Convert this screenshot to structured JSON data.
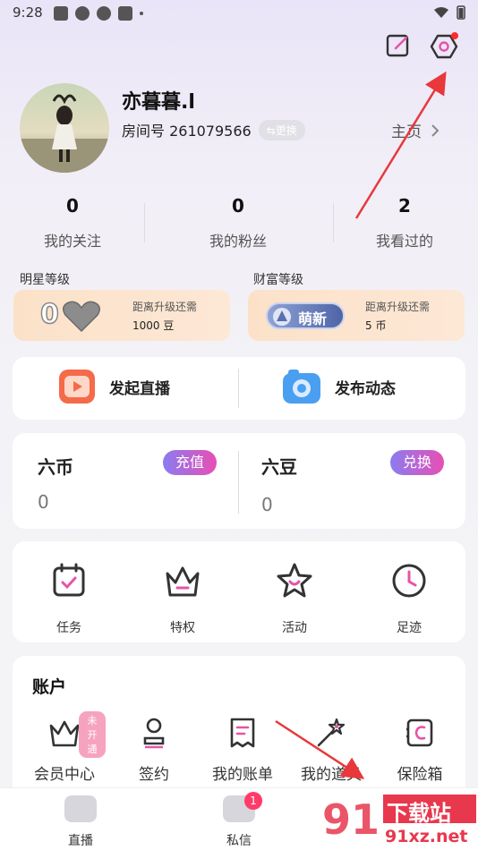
{
  "status_bar": {
    "time": "9:28"
  },
  "profile": {
    "nickname": "亦暮暮.l",
    "room_label": "房间号 261079566",
    "switch_label": "⇆更换",
    "home_label": "主页"
  },
  "stats": [
    {
      "value": "0",
      "label": "我的关注"
    },
    {
      "value": "0",
      "label": "我的粉丝"
    },
    {
      "value": "2",
      "label": "我看过的"
    }
  ],
  "levels": {
    "star": {
      "title": "明星等级",
      "level": "0",
      "sub": "距离升级还需",
      "value": "1000 豆"
    },
    "wealth": {
      "title": "财富等级",
      "badge": "萌新",
      "sub": "距离升级还需",
      "value": "5 币"
    }
  },
  "actions": {
    "live": "发起直播",
    "post": "发布动态"
  },
  "wallet": {
    "coin": {
      "title": "六币",
      "value": "0",
      "button": "充值"
    },
    "bean": {
      "title": "六豆",
      "value": "0",
      "button": "兑换"
    }
  },
  "quick": [
    {
      "label": "任务",
      "icon": "calendar-check-icon"
    },
    {
      "label": "特权",
      "icon": "crown-icon"
    },
    {
      "label": "活动",
      "icon": "star-icon"
    },
    {
      "label": "足迹",
      "icon": "clock-icon"
    }
  ],
  "account": {
    "title": "账户",
    "badge": "未开通",
    "items": [
      {
        "label": "会员中心",
        "icon": "crown-icon"
      },
      {
        "label": "签约",
        "icon": "stamp-icon"
      },
      {
        "label": "我的账单",
        "icon": "receipt-icon"
      },
      {
        "label": "我的道具",
        "icon": "magic-wand-icon"
      },
      {
        "label": "保险箱",
        "icon": "safe-icon"
      }
    ]
  },
  "nav": {
    "live": "直播",
    "messages": "私信",
    "messages_badge": "1"
  },
  "watermark": {
    "text": "下载站",
    "url_text": "91xz.net"
  },
  "colors": {
    "accent": "#e455a8",
    "annotation": "#e8383b",
    "pill_gradient_start": "#8a7cf0",
    "pill_gradient_end": "#e84fb4"
  }
}
